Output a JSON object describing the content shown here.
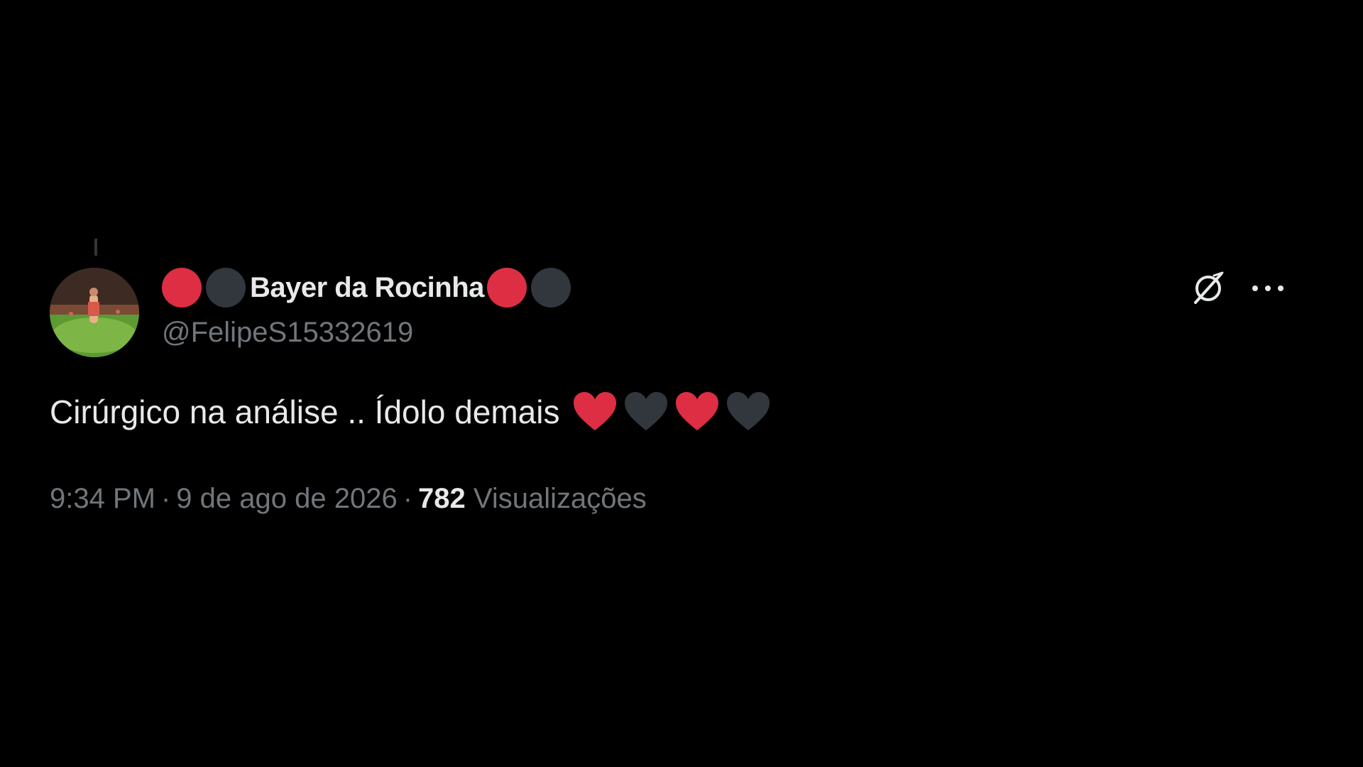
{
  "tweet": {
    "display_name": "Bayer da Rocinha",
    "name_prefix_icons": [
      "red-circle-icon",
      "black-circle-icon"
    ],
    "name_suffix_icons": [
      "red-circle-icon",
      "black-circle-icon"
    ],
    "handle": "@FelipeS15332619",
    "text": "Cirúrgico na análise .. Ídolo demais",
    "text_emojis": [
      "red-heart-icon",
      "black-heart-icon",
      "red-heart-icon",
      "black-heart-icon"
    ],
    "time": "9:34 PM",
    "separator": "·",
    "date": "9 de ago de 2026",
    "views_count": "782",
    "views_label": "Visualizações"
  },
  "icons": {
    "grok_icon": "grok-icon",
    "more_icon": "more-options-icon"
  },
  "colors": {
    "background": "#000000",
    "primary_text": "#e7e9ea",
    "secondary_text": "#71767b",
    "red": "#dd2e44",
    "black_emoji": "#31373d"
  }
}
